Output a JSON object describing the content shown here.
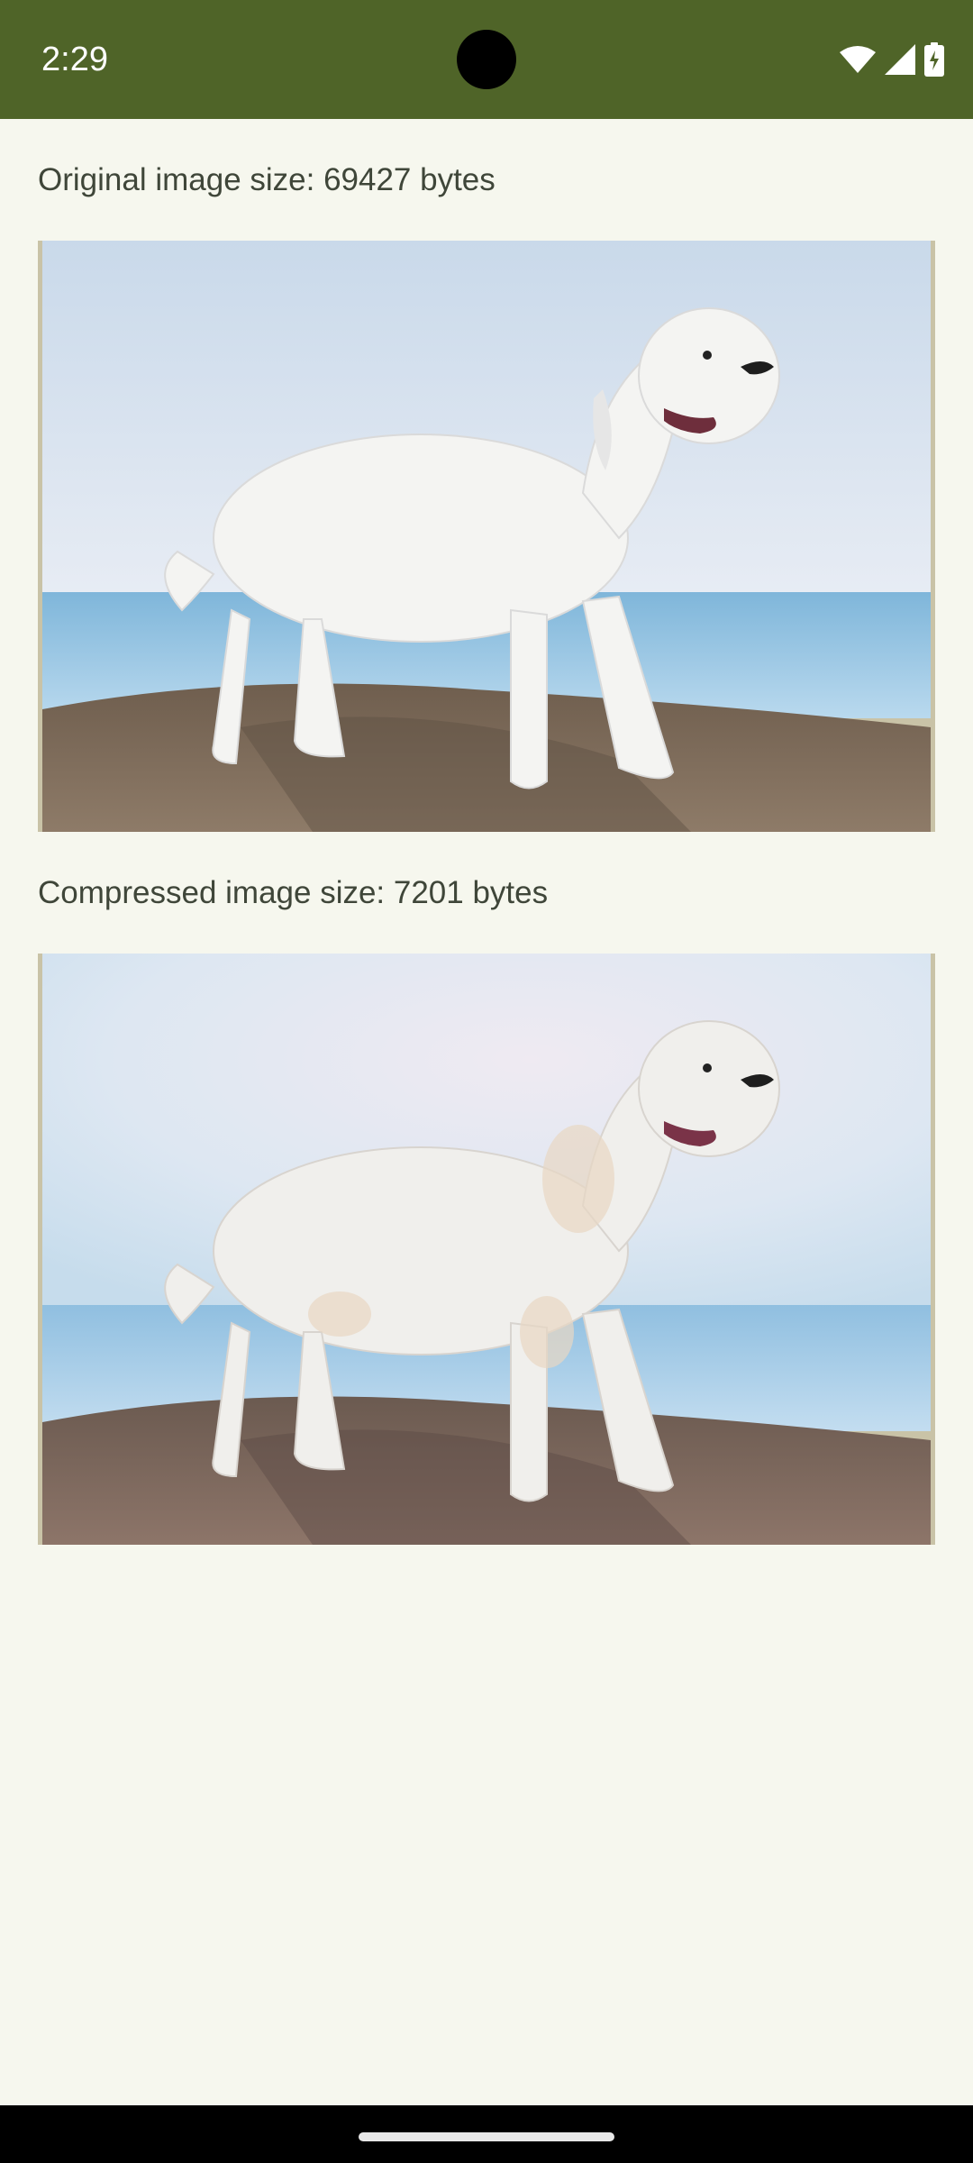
{
  "status_bar": {
    "time": "2:29",
    "icons": [
      "wifi-icon",
      "cellular-signal-icon",
      "battery-charging-icon"
    ],
    "background_color": "#4F6428"
  },
  "main": {
    "original": {
      "caption": "Original image size: 69427 bytes",
      "image_subject": "white dog standing on rock by the sea"
    },
    "compressed": {
      "caption": "Compressed image size: 7201 bytes",
      "image_subject": "white dog standing on rock by the sea (compressed)"
    }
  },
  "colors": {
    "background": "#F6F7EE",
    "text": "#3F4639",
    "accent": "#4F6428"
  }
}
